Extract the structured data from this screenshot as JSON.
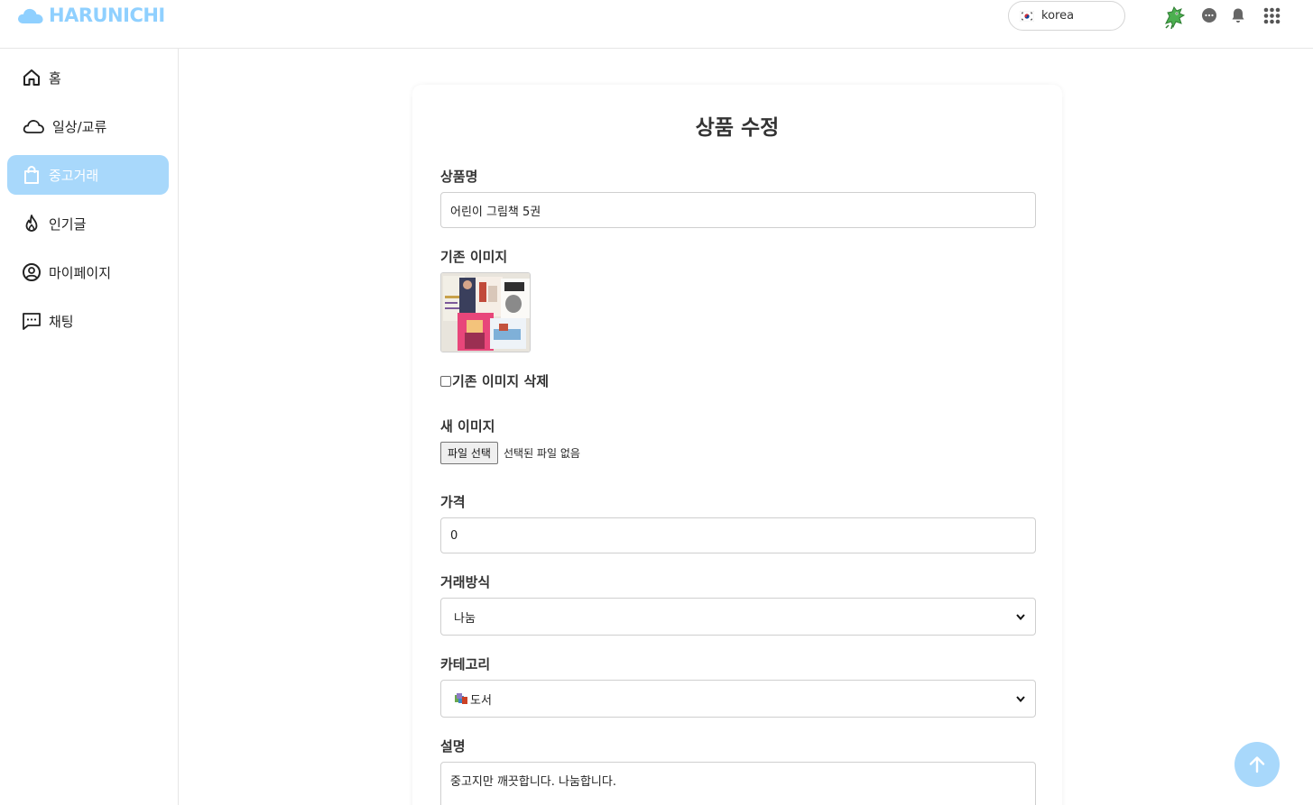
{
  "header": {
    "logo_text": "HARUNICHI",
    "language": "korea",
    "icons": [
      "dragon-avatar-icon",
      "chat-bubble-icon",
      "bell-icon",
      "apps-grid-icon"
    ]
  },
  "sidebar": {
    "items": [
      {
        "label": "홈",
        "icon": "home-icon",
        "active": false
      },
      {
        "label": "일상/교류",
        "icon": "cloud-icon",
        "active": false
      },
      {
        "label": "중고거래",
        "icon": "shopping-bag-icon",
        "active": true
      },
      {
        "label": "인기글",
        "icon": "flame-icon",
        "active": false
      },
      {
        "label": "마이페이지",
        "icon": "user-circle-icon",
        "active": false
      },
      {
        "label": "채팅",
        "icon": "chat-dots-icon",
        "active": false
      }
    ]
  },
  "form": {
    "title": "상품 수정",
    "name_label": "상품명",
    "name_value": "어린이 그림책 5권",
    "existing_image_label": "기존 이미지",
    "delete_image_label": "기존 이미지 삭제",
    "new_image_label": "새 이미지",
    "file_button": "파일 선택",
    "file_status": "선택된 파일 없음",
    "price_label": "가격",
    "price_value": "0",
    "trade_label": "거래방식",
    "trade_value": "나눔",
    "category_label": "카테고리",
    "category_value": "도서",
    "description_label": "설명",
    "description_value": "중고지만 깨끗합니다. 나눔합니다."
  },
  "colors": {
    "accent": "#a8d8fb",
    "logo": "#8fd0ff",
    "border": "#cfcfcf"
  }
}
